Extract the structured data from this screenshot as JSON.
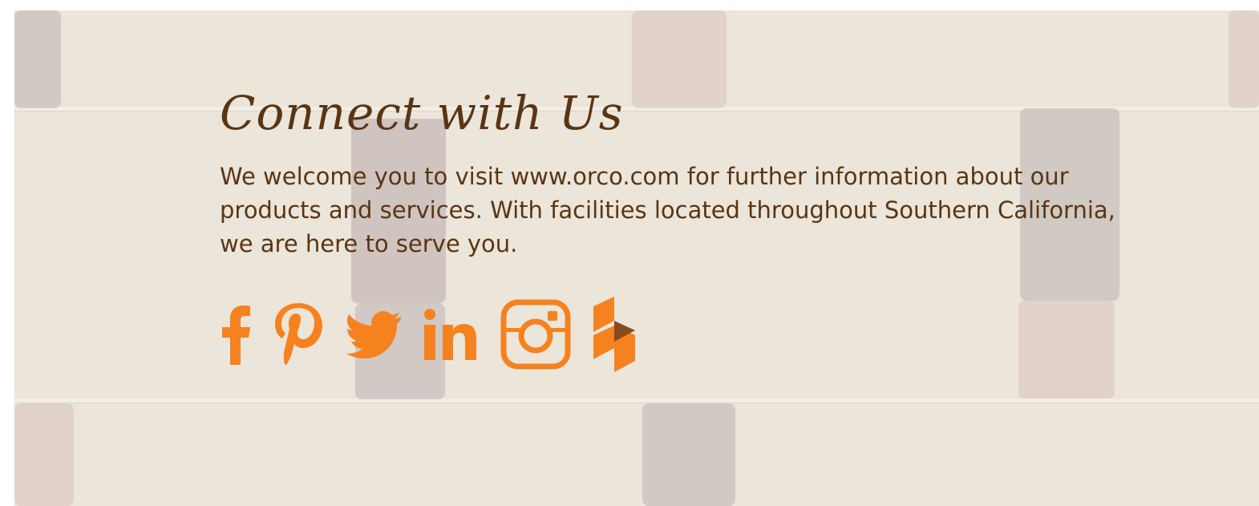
{
  "section": {
    "heading": "Connect with Us",
    "body": "We welcome you to visit www.orco.com for further information about our products and services. With facilities located throughout Southern California, we are here to serve you."
  },
  "social_links": [
    {
      "icon": "facebook-icon"
    },
    {
      "icon": "pinterest-icon"
    },
    {
      "icon": "twitter-icon"
    },
    {
      "icon": "linkedin-icon"
    },
    {
      "icon": "instagram-icon"
    },
    {
      "icon": "houzz-icon"
    }
  ],
  "colors": {
    "accent_orange": "#f5821f",
    "text_brown": "#5a3513",
    "background_stone": "#ebe5da"
  }
}
